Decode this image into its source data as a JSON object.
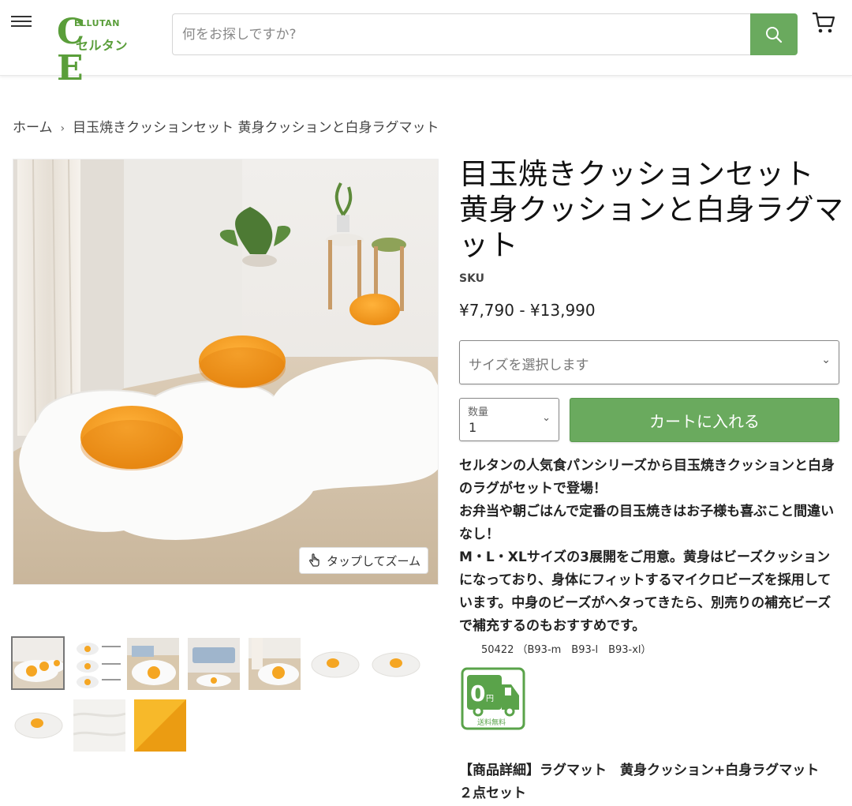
{
  "header": {
    "logo_main_left": "C",
    "logo_main_right": "E",
    "logo_top": "ELLUTAN",
    "logo_kana": "セルタン",
    "search_placeholder": "何をお探しですか?"
  },
  "breadcrumb": {
    "home": "ホーム",
    "separator": "›",
    "current": "目玉焼きクッションセット 黄身クッションと白身ラグマット"
  },
  "gallery": {
    "zoom_hint": "タップしてズーム",
    "thumb_count": 10,
    "selected_index": 0
  },
  "product": {
    "title": "目玉焼きクッションセット 黄身クッションと白身ラグマット",
    "sku_label": "SKU",
    "price": "¥7,790 - ¥13,990",
    "size_placeholder": "サイズを選択します",
    "qty_label": "数量",
    "qty_value": "1",
    "add_to_cart": "カートに入れる",
    "desc_1": "セルタンの人気食パンシリーズから目玉焼きクッションと白身のラグがセットで登場！",
    "desc_2": "お弁当や朝ごはんで定番の目玉焼きはお子様も喜ぶこと間違いなし！",
    "desc_3": "M・L・XLサイズの3展開をご用意。黄身はビーズクッションになっており、身体にフィットするマイクロビーズを採用しています。中身のビーズがヘタってきたら、別売りの補充ビーズで補充するのもおすすめです。",
    "model_codes": "50422 （B93-m　B93-l　B93-xl）",
    "free_shipping_text": "送料無料",
    "detail_heading": "【商品詳細】ラグマット　黄身クッション+白身ラグマット　２点セット"
  },
  "colors": {
    "brand_green": "#6aaa5e",
    "logo_green": "#5a9e3a",
    "yolk": "#f5a623"
  }
}
